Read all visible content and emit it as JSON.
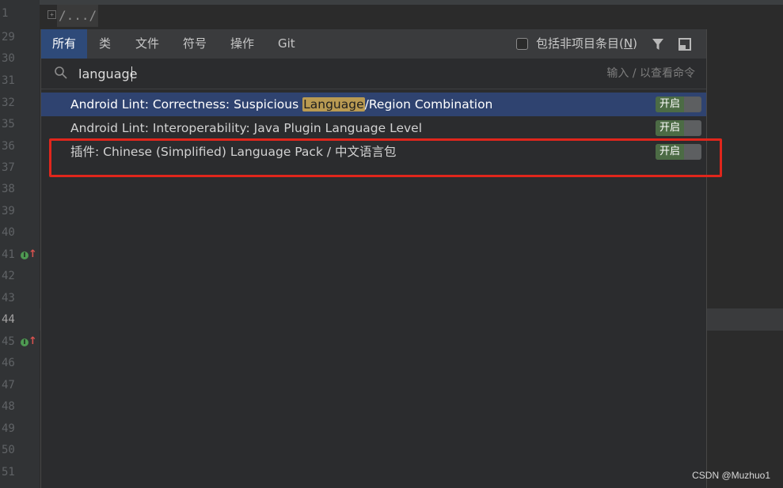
{
  "editor": {
    "line_numbers": [
      "1",
      "29",
      "30",
      "31",
      "32",
      "35",
      "36",
      "37",
      "38",
      "39",
      "40",
      "41",
      "42",
      "43",
      "44",
      "45",
      "46",
      "47",
      "48",
      "49",
      "50",
      "51"
    ],
    "current_line": "44",
    "folded_code": "/.../",
    "fold_marker": "+"
  },
  "popup": {
    "tabs": [
      {
        "label": "所有",
        "active": true
      },
      {
        "label": "类"
      },
      {
        "label": "文件"
      },
      {
        "label": "符号"
      },
      {
        "label": "操作"
      },
      {
        "label": "Git"
      }
    ],
    "include_non_project": {
      "label": "包括非项目条目(",
      "mnemonic": "N",
      "label_end": ")",
      "checked": false
    },
    "search": {
      "value": "language",
      "hint": "输入 / 以查看命令"
    },
    "results": [
      {
        "pre": "Android Lint: Correctness: Suspicious ",
        "match": "Language",
        "post": "/Region Combination",
        "toggle": "开启",
        "selected": true
      },
      {
        "text": "Android Lint: Interoperability: Java Plugin Language Level",
        "toggle": "开启"
      },
      {
        "text": "插件: Chinese (Simplified) Language Pack / 中文语言包",
        "toggle": "开启"
      }
    ]
  },
  "watermark": "CSDN @Muzhuo1",
  "colors": {
    "accent_tab": "#2e4a79",
    "selection": "#2f4370",
    "highlight": "#b99a52",
    "toggle_on": "#4c6b45",
    "annotation": "#e0261c"
  }
}
